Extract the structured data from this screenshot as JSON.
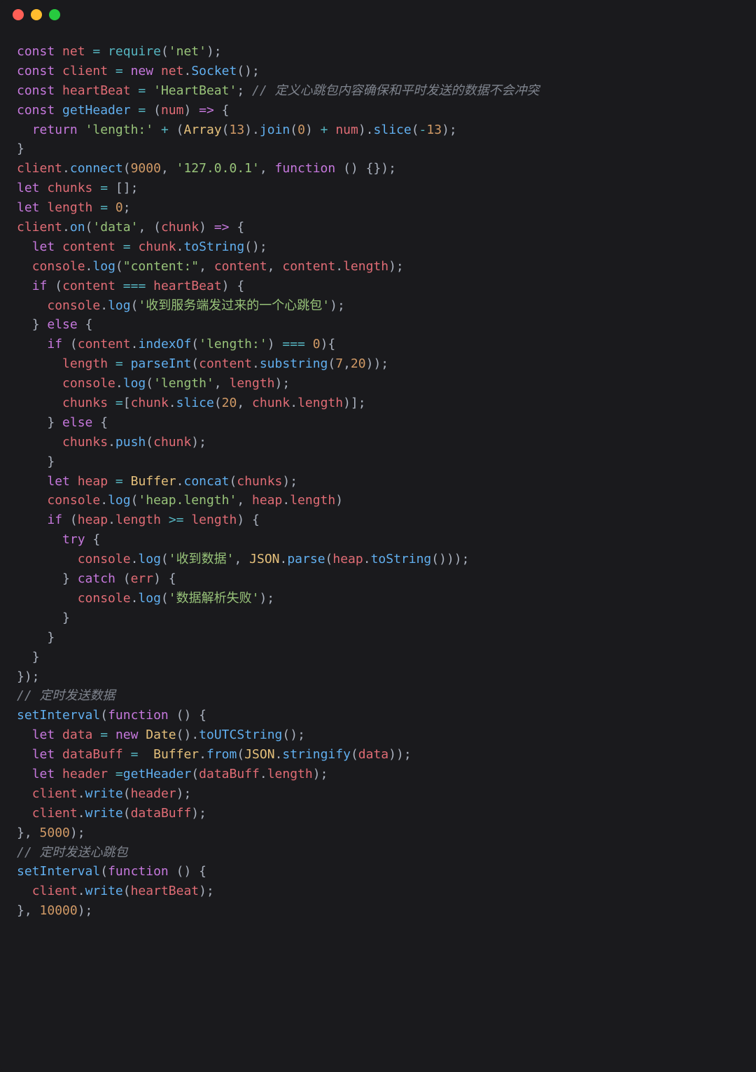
{
  "titlebar": {
    "dots": [
      "red",
      "yellow",
      "green"
    ]
  },
  "code": {
    "l1": {
      "kw1": "const",
      "v": "net",
      "op": "=",
      "fn": "require",
      "p1": "(",
      "s": "'net'",
      "p2": ");"
    },
    "l2": {
      "kw1": "const",
      "v": "client",
      "op": "=",
      "kw2": "new",
      "obj": "net",
      "d": ".",
      "call": "Socket",
      "p": "();"
    },
    "l3": {
      "kw1": "const",
      "v": "heartBeat",
      "op": "=",
      "s": "'HeartBeat'",
      "p": ";",
      "cmt": " // 定义心跳包内容确保和平时发送的数据不会冲突"
    },
    "l4": {
      "kw1": "const",
      "v": "getHeader",
      "op": "=",
      "p1": "(",
      "arg": "num",
      "p2": ") ",
      "arr": "=>",
      "p3": " {"
    },
    "l5": {
      "kw": "return",
      "s1": "'length:'",
      "op1": "+",
      "p1": "(",
      "obj": "Array",
      "p2": "(",
      "n1": "13",
      "p3": ").",
      "call1": "join",
      "p4": "(",
      "n2": "0",
      "p5": ") ",
      "op2": "+",
      "arg": "num",
      "p6": ").",
      "call2": "slice",
      "p7": "(",
      "op3": "-",
      "n3": "13",
      "p8": ");"
    },
    "l6": {
      "p": "}"
    },
    "l7": {
      "v": "client",
      "d": ".",
      "call": "connect",
      "p1": "(",
      "n": "9000",
      "c": ",",
      "s": "'127.0.0.1'",
      "c2": ",",
      "kw": "function",
      "p2": " () {});"
    },
    "l8": {
      "kw": "let",
      "v": "chunks",
      "op": "=",
      "p": "[];"
    },
    "l9": {
      "kw": "let",
      "v": "length",
      "op": "=",
      "n": "0",
      "p": ";"
    },
    "l10": {
      "v": "client",
      "d": ".",
      "call": "on",
      "p1": "(",
      "s": "'data'",
      "c": ",",
      "p2": "(",
      "arg": "chunk",
      "p3": ") ",
      "arr": "=>",
      "p4": " {"
    },
    "l11": {
      "kw": "let",
      "v": "content",
      "op": "=",
      "arg": "chunk",
      "d": ".",
      "call": "toString",
      "p": "();"
    },
    "l12": {
      "v": "console",
      "d": ".",
      "call": "log",
      "p1": "(",
      "s": "\"content:\"",
      "c1": ",",
      "arg1": "content",
      "c2": ",",
      "arg2": "content",
      "d2": ".",
      "prop": "length",
      "p2": ");"
    },
    "l13": {
      "kw": "if",
      "p1": "(",
      "arg": "content",
      "op": "===",
      "v": "heartBeat",
      "p2": ") {"
    },
    "l14": {
      "v": "console",
      "d": ".",
      "call": "log",
      "p1": "(",
      "s": "'收到服务端发过来的一个心跳包'",
      "p2": ");"
    },
    "l15": {
      "p1": "} ",
      "kw": "else",
      "p2": " {"
    },
    "l16": {
      "kw": "if",
      "p1": "(",
      "arg": "content",
      "d": ".",
      "call": "indexOf",
      "p2": "(",
      "s": "'length:'",
      "p3": ") ",
      "op": "===",
      "n": "0",
      "p4": "){"
    },
    "l17": {
      "v": "length",
      "op": "=",
      "call": "parseInt",
      "p1": "(",
      "arg": "content",
      "d": ".",
      "call2": "substring",
      "p2": "(",
      "n1": "7",
      "c": ",",
      "n2": "20",
      "p3": "));"
    },
    "l18": {
      "v": "console",
      "d": ".",
      "call": "log",
      "p1": "(",
      "s": "'length'",
      "c": ",",
      "arg": "length",
      "p2": ");"
    },
    "l19": {
      "v": "chunks",
      "op": "=",
      "p1": "[",
      "arg": "chunk",
      "d": ".",
      "call": "slice",
      "p2": "(",
      "n": "20",
      "c": ",",
      "arg2": "chunk",
      "d2": ".",
      "prop": "length",
      "p3": ")];"
    },
    "l20": {
      "p1": "} ",
      "kw": "else",
      "p2": " {"
    },
    "l21": {
      "v": "chunks",
      "d": ".",
      "call": "push",
      "p1": "(",
      "arg": "chunk",
      "p2": ");"
    },
    "l22": {
      "p": "}"
    },
    "l23": {
      "kw": "let",
      "v": "heap",
      "op": "=",
      "obj": "Buffer",
      "d": ".",
      "call": "concat",
      "p1": "(",
      "arg": "chunks",
      "p2": ");"
    },
    "l24": {
      "v": "console",
      "d": ".",
      "call": "log",
      "p1": "(",
      "s": "'heap.length'",
      "c": ",",
      "arg": "heap",
      "d2": ".",
      "prop": "length",
      "p2": ")"
    },
    "l25": {
      "kw": "if",
      "p1": "(",
      "arg": "heap",
      "d": ".",
      "prop": "length",
      "op": ">=",
      "arg2": "length",
      "p2": ") {"
    },
    "l26": {
      "kw": "try",
      "p": " {"
    },
    "l27": {
      "v": "console",
      "d": ".",
      "call": "log",
      "p1": "(",
      "s": "'收到数据'",
      "c": ",",
      "obj": "JSON",
      "d2": ".",
      "call2": "parse",
      "p2": "(",
      "arg": "heap",
      "d3": ".",
      "call3": "toString",
      "p3": "()));"
    },
    "l28": {
      "p1": "} ",
      "kw": "catch",
      "p2": " (",
      "arg": "err",
      "p3": ") {"
    },
    "l29": {
      "v": "console",
      "d": ".",
      "call": "log",
      "p1": "(",
      "s": "'数据解析失败'",
      "p2": ");"
    },
    "l30": {
      "p": "}"
    },
    "l31": {
      "p": "}"
    },
    "l32": {
      "p": "}"
    },
    "l33": {
      "p": "});"
    },
    "l34": {
      "cmt": "// 定时发送数据"
    },
    "l35": {
      "call": "setInterval",
      "p1": "(",
      "kw": "function",
      "p2": " () {"
    },
    "l36": {
      "kw": "let",
      "v": "data",
      "op": "=",
      "kw2": "new",
      "obj": "Date",
      "p1": "().",
      "call": "toUTCString",
      "p2": "();"
    },
    "l37": {
      "kw": "let",
      "v": "dataBuff",
      "op": "=",
      "obj": "Buffer",
      "d": ".",
      "call": "from",
      "p1": "(",
      "obj2": "JSON",
      "d2": ".",
      "call2": "stringify",
      "p2": "(",
      "arg": "data",
      "p3": "));"
    },
    "l38": {
      "kw": "let",
      "v": "header",
      "op": "=",
      "call": "getHeader",
      "p1": "(",
      "arg": "dataBuff",
      "d": ".",
      "prop": "length",
      "p2": ");"
    },
    "l39": {
      "v": "client",
      "d": ".",
      "call": "write",
      "p1": "(",
      "arg": "header",
      "p2": ");"
    },
    "l40": {
      "v": "client",
      "d": ".",
      "call": "write",
      "p1": "(",
      "arg": "dataBuff",
      "p2": ");"
    },
    "l41": {
      "p1": "}, ",
      "n": "5000",
      "p2": ");"
    },
    "l42": {
      "cmt": "// 定时发送心跳包"
    },
    "l43": {
      "call": "setInterval",
      "p1": "(",
      "kw": "function",
      "p2": " () {"
    },
    "l44": {
      "v": "client",
      "d": ".",
      "call": "write",
      "p1": "(",
      "arg": "heartBeat",
      "p2": ");"
    },
    "l45": {
      "p1": "}, ",
      "n": "10000",
      "p2": ");"
    }
  }
}
